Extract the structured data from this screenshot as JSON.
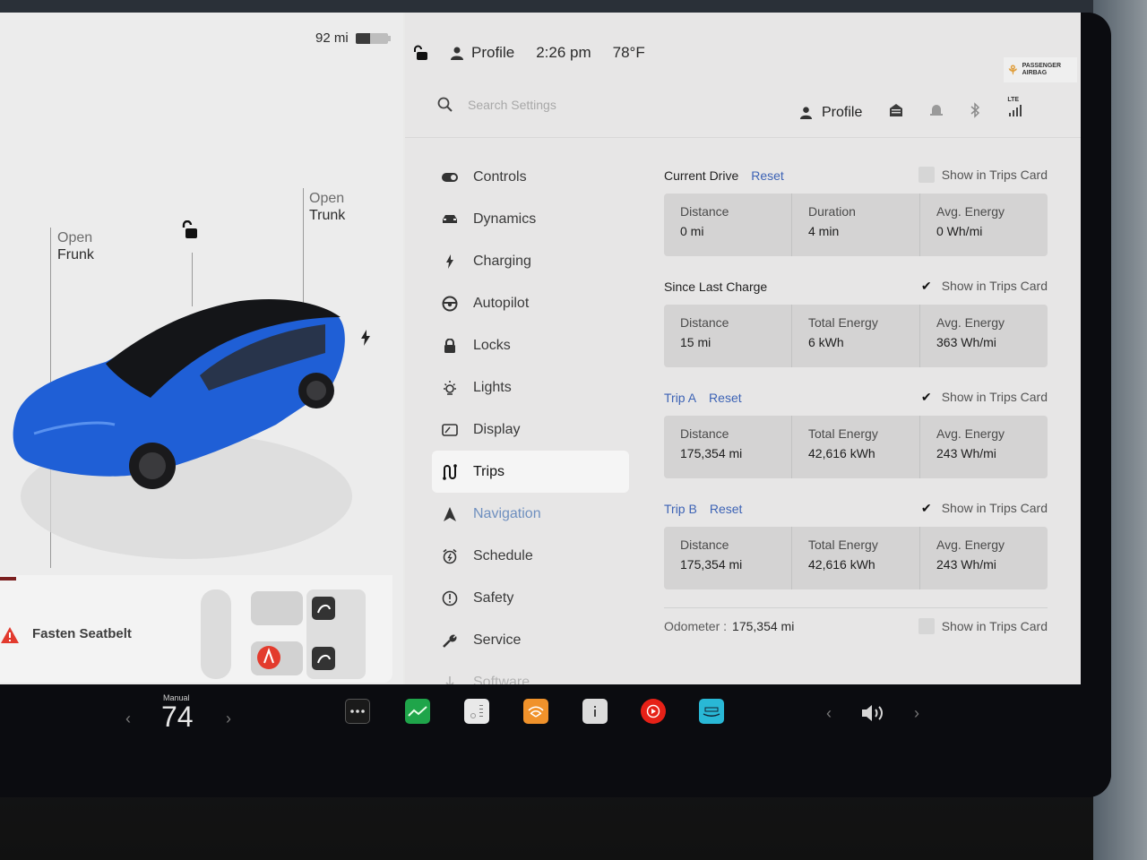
{
  "status_bar": {
    "range": "92 mi",
    "battery_level_percent": 44,
    "profile_label": "Profile",
    "time": "2:26 pm",
    "temperature": "78°F",
    "airbag_line1": "PASSENGER",
    "airbag_line2": "AIRBAG"
  },
  "car_panel": {
    "frunk_line1": "Open",
    "frunk_line2": "Frunk",
    "trunk_line1": "Open",
    "trunk_line2": "Trunk",
    "car_color": "#1f5fd6",
    "seatbelt_warning": "Fasten Seatbelt"
  },
  "settings": {
    "search_placeholder": "Search Settings",
    "profile_label": "Profile",
    "network_label": "LTE",
    "nav": [
      {
        "label": "Controls",
        "icon": "toggle-icon"
      },
      {
        "label": "Dynamics",
        "icon": "car-icon"
      },
      {
        "label": "Charging",
        "icon": "bolt-icon"
      },
      {
        "label": "Autopilot",
        "icon": "steering-wheel-icon"
      },
      {
        "label": "Locks",
        "icon": "lock-icon"
      },
      {
        "label": "Lights",
        "icon": "sun-icon"
      },
      {
        "label": "Display",
        "icon": "display-icon"
      },
      {
        "label": "Trips",
        "icon": "trips-icon",
        "active": true
      },
      {
        "label": "Navigation",
        "icon": "navigation-arrow-icon"
      },
      {
        "label": "Schedule",
        "icon": "alarm-clock-icon"
      },
      {
        "label": "Safety",
        "icon": "alert-circle-icon"
      },
      {
        "label": "Service",
        "icon": "wrench-icon"
      },
      {
        "label": "Software",
        "icon": "download-icon"
      }
    ],
    "show_in_trips_card_label": "Show in Trips Card",
    "reset_label": "Reset",
    "current_drive": {
      "title": "Current Drive",
      "show_in_card": false,
      "stats": [
        {
          "label": "Distance",
          "value": "0 mi"
        },
        {
          "label": "Duration",
          "value": "4 min"
        },
        {
          "label": "Avg. Energy",
          "value": "0 Wh/mi"
        }
      ]
    },
    "since_last_charge": {
      "title": "Since Last Charge",
      "show_in_card": true,
      "stats": [
        {
          "label": "Distance",
          "value": "15 mi"
        },
        {
          "label": "Total Energy",
          "value": "6 kWh"
        },
        {
          "label": "Avg. Energy",
          "value": "363 Wh/mi"
        }
      ]
    },
    "trip_a": {
      "title": "Trip A",
      "show_in_card": true,
      "stats": [
        {
          "label": "Distance",
          "value": "175,354 mi"
        },
        {
          "label": "Total Energy",
          "value": "42,616 kWh"
        },
        {
          "label": "Avg. Energy",
          "value": "243 Wh/mi"
        }
      ]
    },
    "trip_b": {
      "title": "Trip B",
      "show_in_card": true,
      "stats": [
        {
          "label": "Distance",
          "value": "175,354 mi"
        },
        {
          "label": "Total Energy",
          "value": "42,616 kWh"
        },
        {
          "label": "Avg. Energy",
          "value": "243 Wh/mi"
        }
      ]
    },
    "odometer": {
      "label": "Odometer :",
      "value": "175,354 mi",
      "show_in_card": false
    }
  },
  "taskbar": {
    "climate_mode": "Manual",
    "temperature": "74",
    "apps": [
      {
        "name": "more-apps",
        "color": "#1a1a1a"
      },
      {
        "name": "energy-app",
        "color": "#1fa54a"
      },
      {
        "name": "calendar-app",
        "color": "#e9e9e9"
      },
      {
        "name": "audible-app",
        "color": "#f0922b"
      },
      {
        "name": "owners-manual-app",
        "color": "#dcdcdc"
      },
      {
        "name": "youtube-music-app",
        "color": "#e62117"
      },
      {
        "name": "amazon-music-app",
        "color": "#29b8d6"
      }
    ]
  }
}
